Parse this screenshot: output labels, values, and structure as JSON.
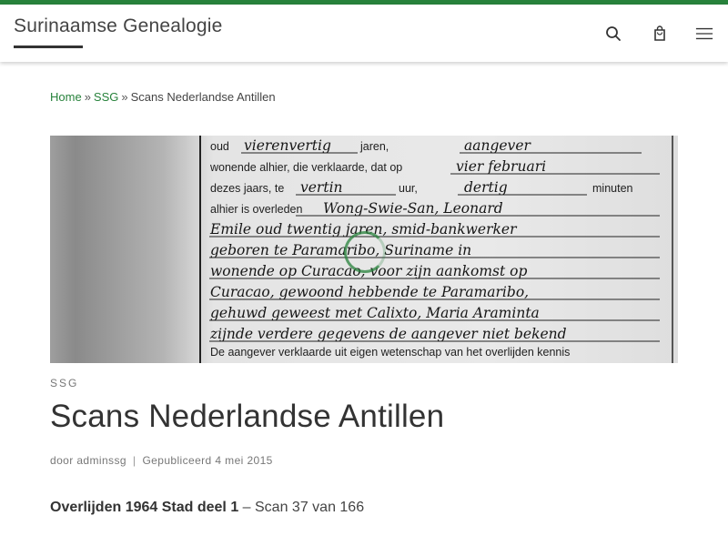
{
  "header": {
    "site_title": "Surinaamse Genealogie",
    "accent_color": "#27823b",
    "icons": [
      "search-icon",
      "shopping-bag-icon",
      "hamburger-menu-icon"
    ]
  },
  "breadcrumb": {
    "home": "Home",
    "separator": "»",
    "section": "SSG",
    "current": "Scans Nederlandse Antillen"
  },
  "hero": {
    "printed_lines": [
      "oud",
      "jaren,",
      "wonende alhier, die verklaarde, dat op",
      "dezes jaars, te",
      "uur,",
      "minuten",
      "alhier is overleden",
      "De aangever verklaarde uit eigen wetenschap van het overlijden kennis"
    ],
    "handwritten_lines": [
      "vierenvertig",
      "aangever",
      "vier februari",
      "vertin",
      "dertig",
      "Wong-Swie-San, Leonard",
      "Emile oud twentig jaren, smid-bankwerker",
      "geboren te Paramaribo, Suriname in",
      "wonende op Curacao, voor zijn aankomst op",
      "Curacao, gewoond hebbende te Paramaribo,",
      "gehuwd geweest met Calixto, Maria Araminta",
      "zijnde verdere gegevens de aangever niet bekend"
    ]
  },
  "post": {
    "category": "SSG",
    "title": "Scans Nederlandse Antillen",
    "by_label": "door",
    "author": "adminssg",
    "published_label": "Gepubliceerd",
    "date": "4 mei 2015",
    "content_bold": "Overlijden 1964 Stad deel 1",
    "content_rest": " – Scan 37 van 166"
  }
}
